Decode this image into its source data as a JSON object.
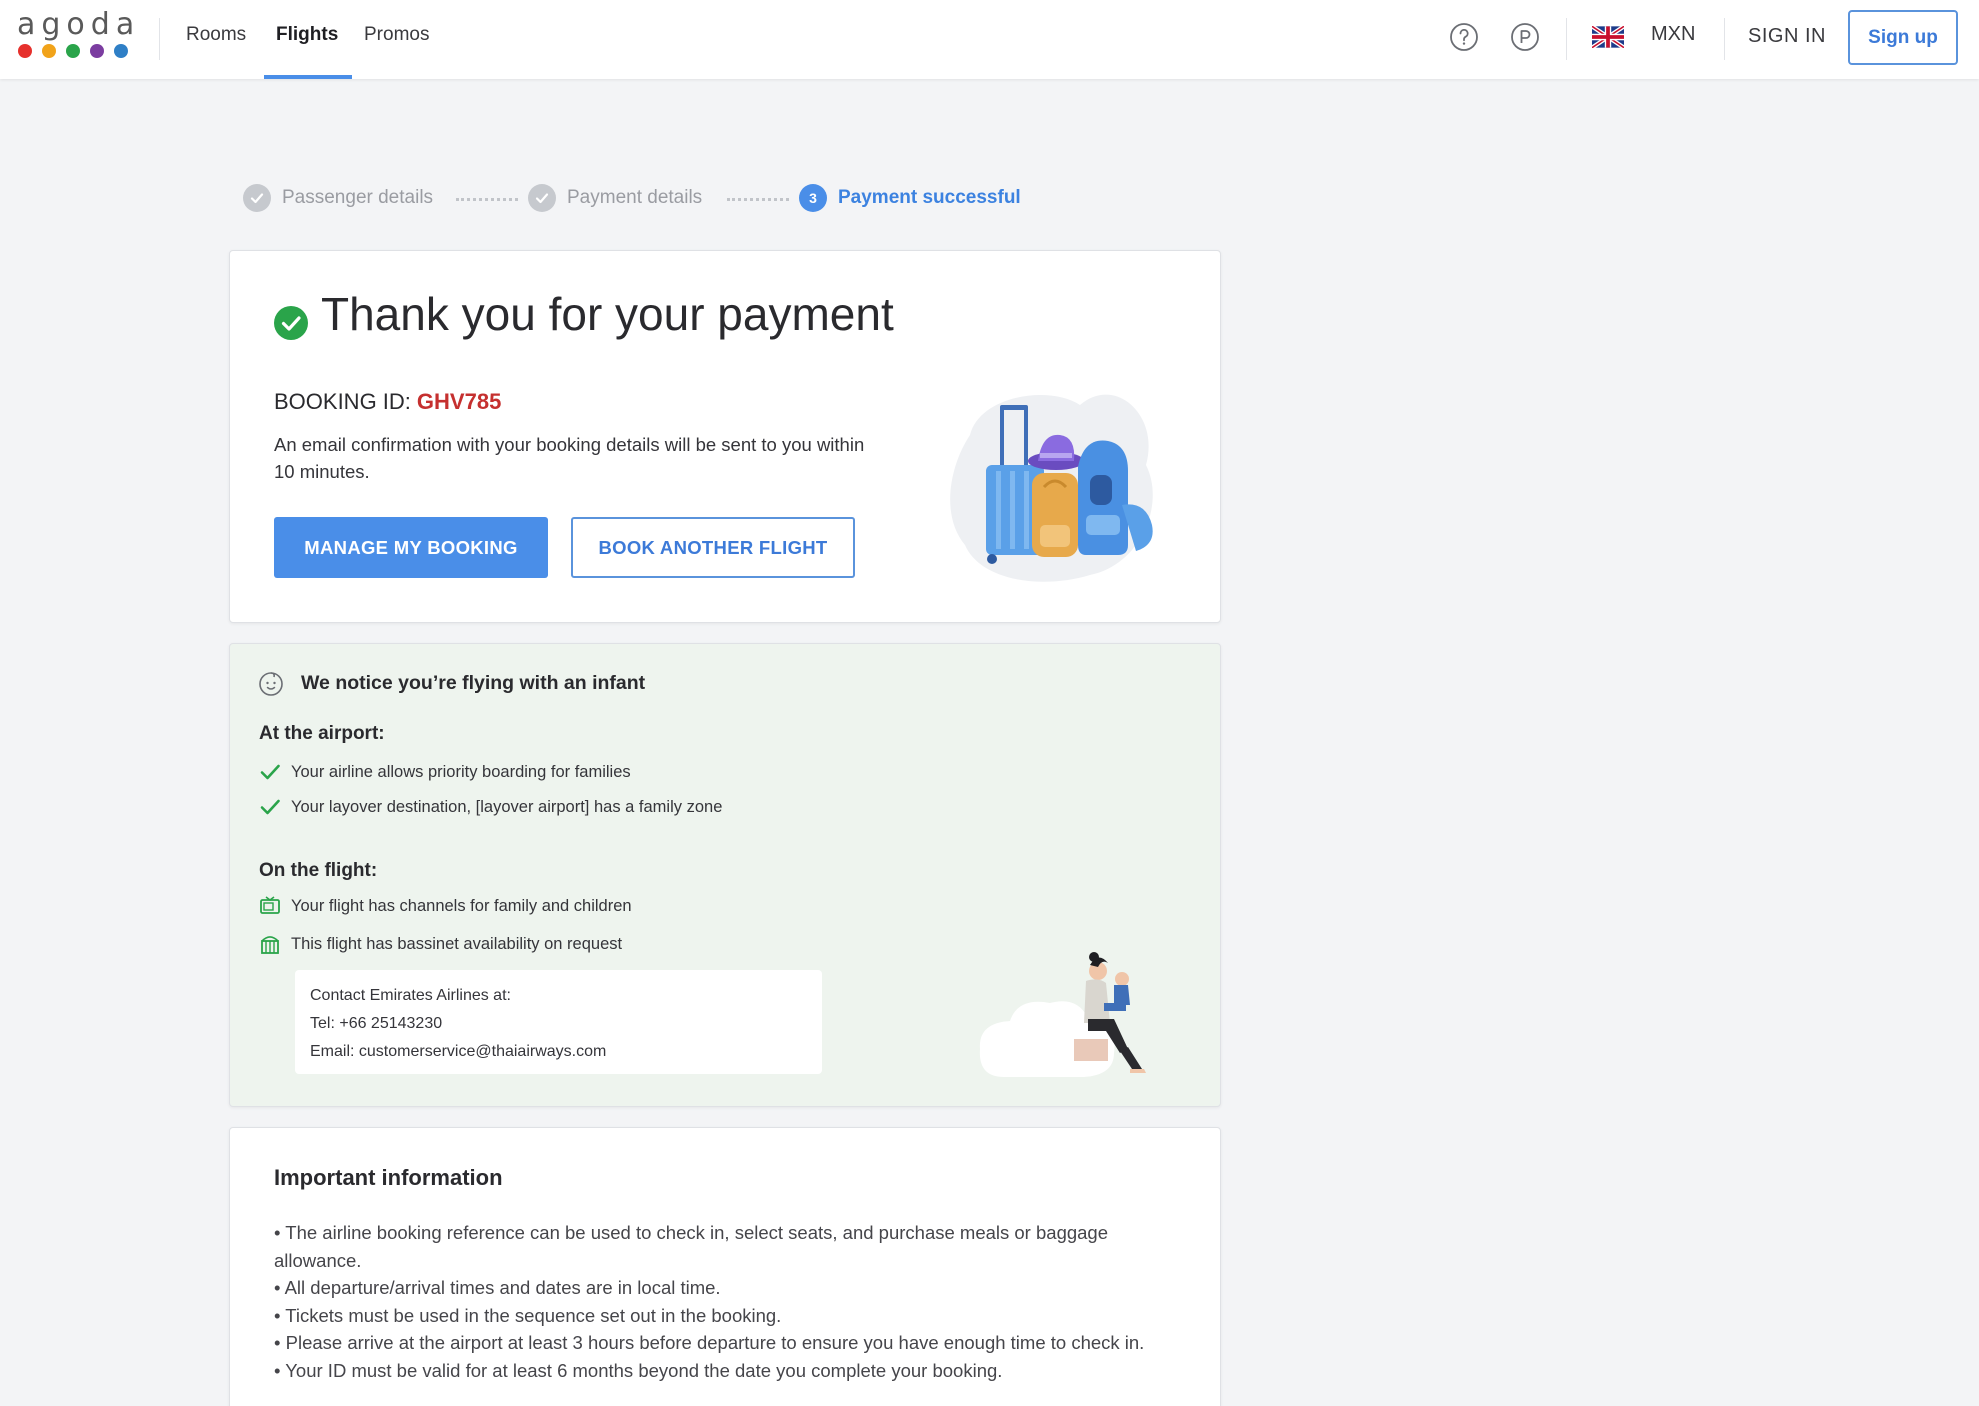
{
  "header": {
    "logo_text": "agoda",
    "logo_dot_colors": [
      "#e6302c",
      "#f1a31a",
      "#2aa44a",
      "#7b3da0",
      "#2f7fc6"
    ],
    "nav": [
      {
        "label": "Rooms"
      },
      {
        "label": "Flights",
        "active": true
      },
      {
        "label": "Promos"
      }
    ],
    "icons": [
      "help-icon",
      "points-icon",
      "uk-flag-icon"
    ],
    "currency": "MXN",
    "signin_label": "SIGN IN",
    "signup_label": "Sign up",
    "accent": "#4a8ee8"
  },
  "stepper": {
    "steps": [
      {
        "label": "Passenger details",
        "state": "done"
      },
      {
        "label": "Payment details",
        "state": "done"
      },
      {
        "label": "Payment successful",
        "state": "current",
        "number": "3"
      }
    ]
  },
  "confirmation": {
    "title": "Thank you for your payment",
    "booking_id_label": "BOOKING ID:",
    "booking_id": "GHV785",
    "email_note": "An email confirmation with your booking details will be sent to you within 10 minutes.",
    "manage_button": "MANAGE MY BOOKING",
    "another_button": "BOOK ANOTHER FLIGHT",
    "booking_id_color": "#c5302f"
  },
  "infant": {
    "title": "We notice you’re flying with an infant",
    "airport_heading": "At the airport:",
    "airport_items": [
      "Your airline allows priority boarding for families",
      "Your layover destination, [layover airport] has a family zone"
    ],
    "flight_heading": "On the flight:",
    "flight_items": [
      {
        "icon": "tv-icon",
        "text": "Your flight has channels for family and children"
      },
      {
        "icon": "bassinet-icon",
        "text": "This flight has bassinet availability on request"
      }
    ],
    "contact": {
      "heading": "Contact Emirates Airlines at:",
      "tel": "Tel: +66 25143230",
      "email": "Email: customerservice@thaiairways.com"
    },
    "background": "#eef4ee"
  },
  "important": {
    "title": "Important information",
    "items": [
      "• The airline booking reference can be used to check in, select seats, and purchase meals or baggage allowance.",
      "• All departure/arrival times and dates are in local time.",
      "• Tickets must be used in the sequence set out in the booking.",
      "• Please arrive at the airport at least 3 hours before departure to ensure you have enough time to check in.",
      "• Your ID must be valid for at least 6 months beyond the date you complete your booking."
    ]
  }
}
